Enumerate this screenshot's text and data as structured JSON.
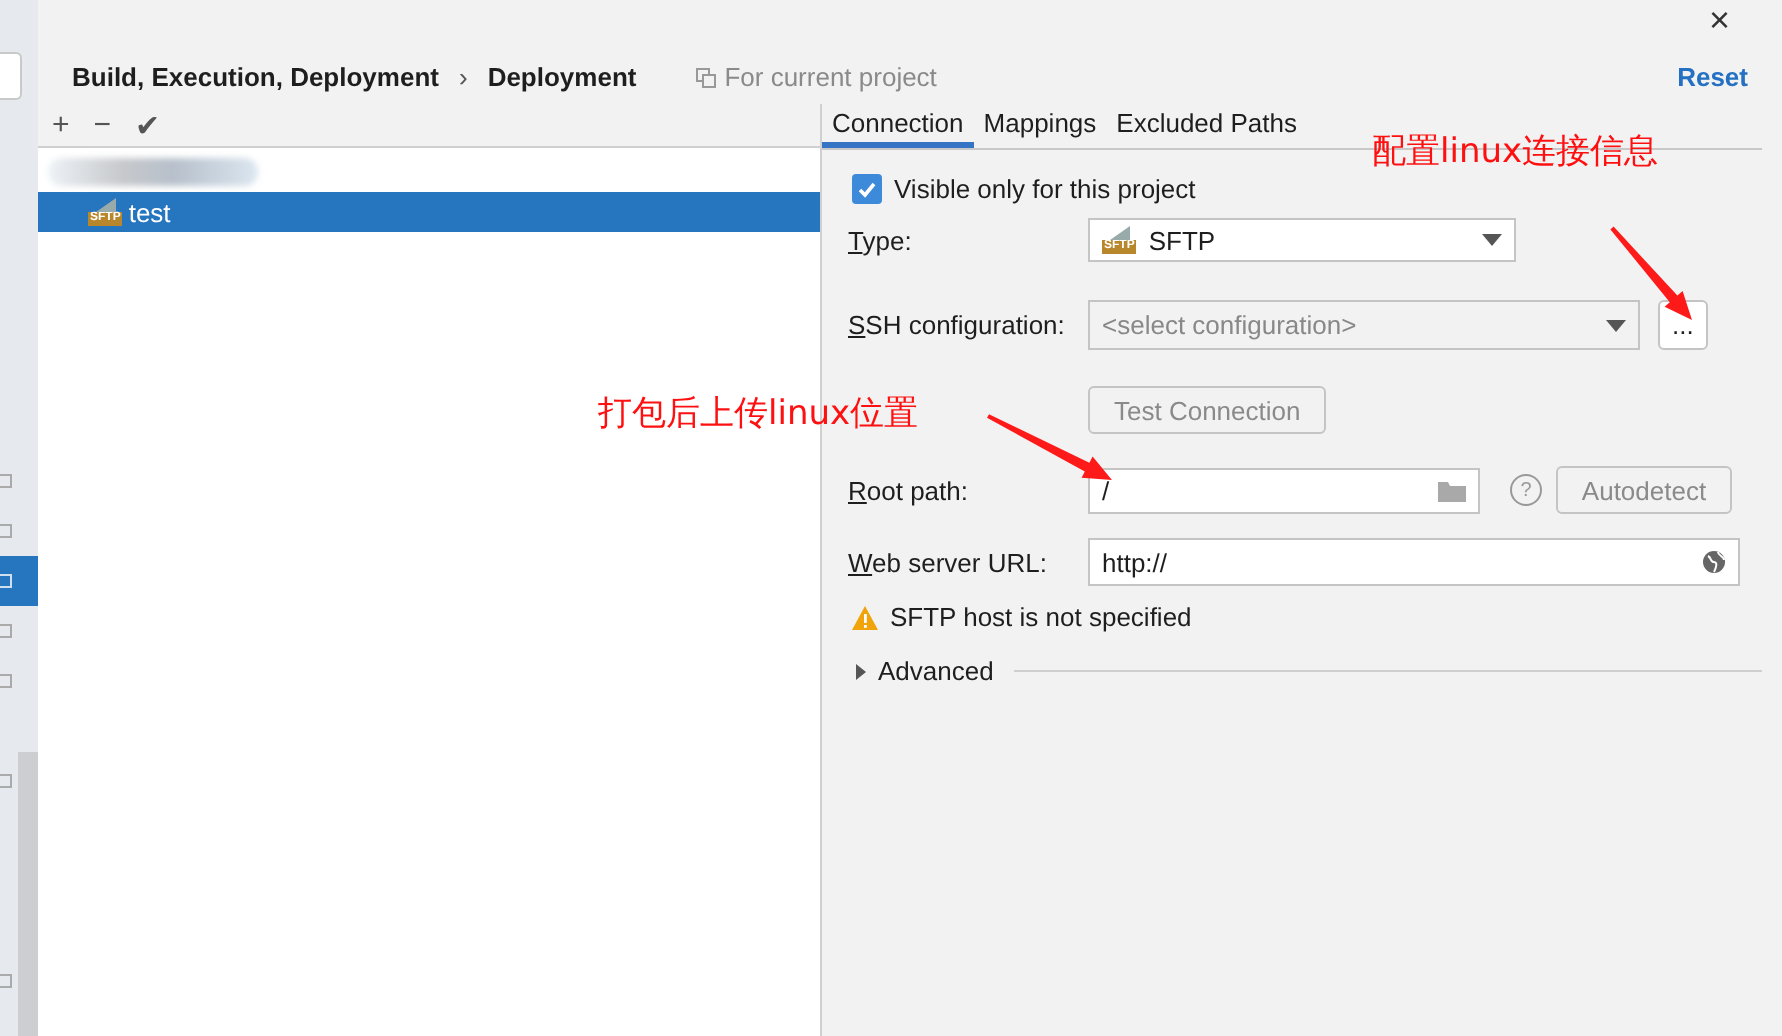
{
  "header": {
    "close": "×",
    "breadcrumb": [
      "Build, Execution, Deployment",
      "Deployment"
    ],
    "separator": "›",
    "scope": "For current project",
    "reset": "Reset"
  },
  "side_strip": [
    {
      "selected": false
    },
    {
      "selected": false
    },
    {
      "selected": true
    },
    {
      "selected": false
    },
    {
      "selected": false
    },
    {
      "selected": false
    },
    {
      "selected": false
    }
  ],
  "toolbar": [
    "+",
    "−",
    "✔"
  ],
  "tree": [
    {
      "kind": "redacted"
    },
    {
      "kind": "server",
      "label": "test",
      "badge": "SFTP",
      "selected": true
    }
  ],
  "tabs": [
    {
      "label": "Connection",
      "selected": true
    },
    {
      "label": "Mappings",
      "selected": false
    },
    {
      "label": "Excluded Paths",
      "selected": false
    }
  ],
  "form": {
    "visible_only": {
      "label": "Visible only for this project",
      "checked": true
    },
    "type": {
      "label": "Type:",
      "value": "SFTP",
      "badge": "SFTP"
    },
    "ssh": {
      "label": "SSH configuration:",
      "placeholder": "<select configuration>",
      "browse": "..."
    },
    "test_button": {
      "label": "Test Connection",
      "disabled": true
    },
    "root_path": {
      "label": "Root path:",
      "value": "/",
      "help": "?",
      "autodetect": "Autodetect"
    },
    "web_url": {
      "label": "Web server URL:",
      "value": "http://"
    },
    "warning": "SFTP host is not specified",
    "advanced": {
      "label": "Advanced",
      "expanded": false
    }
  },
  "annotations": [
    {
      "text": "配置linux连接信息"
    },
    {
      "text": "打包后上传linux位置"
    }
  ]
}
